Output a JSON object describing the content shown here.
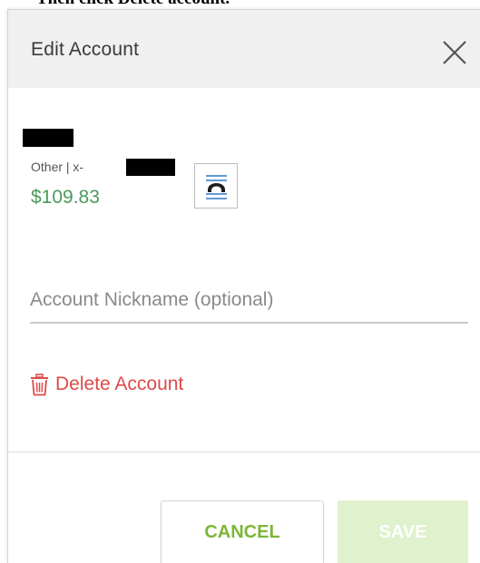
{
  "caption": "Then click Delete account.",
  "dialog": {
    "title": "Edit Account",
    "close_icon": "close-icon"
  },
  "account": {
    "type_prefix": "Other | x-",
    "balance": "$109.83",
    "balance_color": "#4a9a5a",
    "logo_icon": "bank-logo-icon"
  },
  "form": {
    "nickname_value": "",
    "nickname_placeholder": "Account Nickname (optional)"
  },
  "actions": {
    "delete_label": "Delete Account",
    "delete_icon": "trash-icon",
    "delete_color": "#dd4a4a",
    "cancel_label": "CANCEL",
    "save_label": "SAVE",
    "accent_color": "#7cb637",
    "save_disabled_color": "#dff1cd"
  }
}
